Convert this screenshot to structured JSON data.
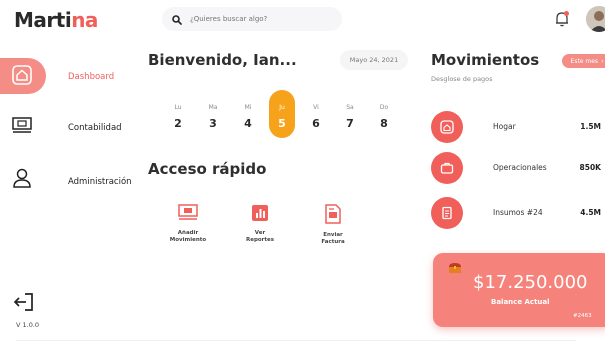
{
  "brand": {
    "name_main": "Marti",
    "name_accent": "na",
    "accent_color": "#f15f5b"
  },
  "search": {
    "placeholder": "¿Quieres buscar algo?",
    "icon": "search-icon"
  },
  "header": {
    "notification_icon": "bell-icon",
    "notification_dot_color": "#f15f5b"
  },
  "sidebar": {
    "items": [
      {
        "label": "Dashboard",
        "icon": "home-icon",
        "active": true
      },
      {
        "label": "Contabilidad",
        "icon": "accounting-icon",
        "active": false
      },
      {
        "label": "Administración",
        "icon": "user-icon",
        "active": false
      }
    ],
    "logout_icon": "logout-icon",
    "version": "V 1.0.0"
  },
  "main": {
    "welcome": "Bienvenido, Ian...",
    "date": "Mayo 24, 2021",
    "days": [
      {
        "name": "Lu",
        "num": "2"
      },
      {
        "name": "Ma",
        "num": "3"
      },
      {
        "name": "Mi",
        "num": "4"
      },
      {
        "name": "Ju",
        "num": "5",
        "active": true
      },
      {
        "name": "Vi",
        "num": "6"
      },
      {
        "name": "Sa",
        "num": "7"
      },
      {
        "name": "Do",
        "num": "8"
      }
    ],
    "quick_title": "Acceso rápido",
    "quick_items": [
      {
        "line1": "Añadir",
        "line2": "Movimiento",
        "icon": "money-icon"
      },
      {
        "line1": "Ver",
        "line2": "Reportes",
        "icon": "report-icon"
      },
      {
        "line1": "Enviar",
        "line2": "Factura",
        "icon": "invoice-icon"
      }
    ]
  },
  "movements": {
    "title": "Movimientos",
    "subtitle": "Desglose de pagos",
    "filter": "Este mes",
    "rows": [
      {
        "name": "Hogar",
        "amount": "1.5M",
        "icon": "home-icon"
      },
      {
        "name": "Operacionales",
        "amount": "850K",
        "icon": "briefcase-icon"
      },
      {
        "name": "Insumos #24",
        "amount": "4.5M",
        "icon": "document-icon"
      }
    ]
  },
  "balance": {
    "amount": "$17.250.000",
    "label": "Balance Actual",
    "code": "#2463",
    "icon": "treasure-chest-icon",
    "color": "#f5837b"
  }
}
